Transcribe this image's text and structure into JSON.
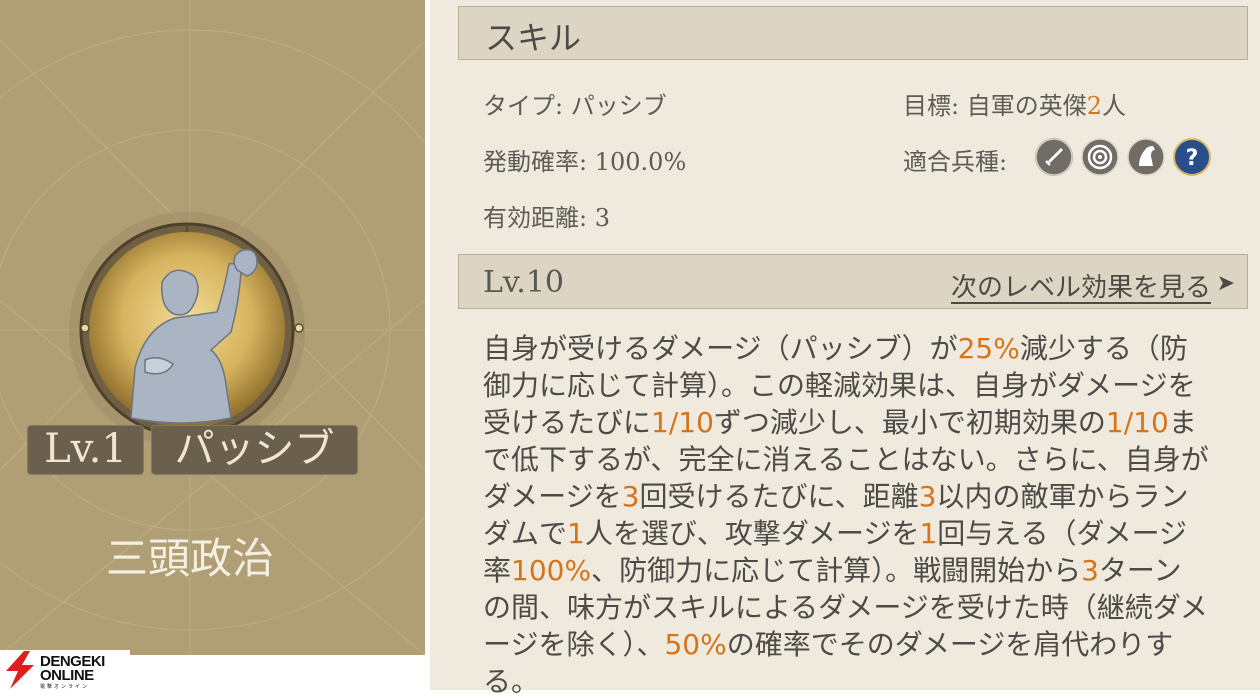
{
  "skill_card": {
    "level_badge": "Lv.1",
    "type_badge": "パッシブ",
    "skill_name": "三頭政治",
    "background_color": "#b09f75"
  },
  "branding": {
    "line1": "DENGEKI",
    "line2": "ONLINE",
    "line3": "電撃オンライン",
    "bolt_color": "#e01e1e"
  },
  "skill_panel": {
    "header_title": "スキル",
    "stats": {
      "type_label": "タイプ:",
      "type_value": "パッシブ",
      "target_label": "目標:",
      "target_value_prefix": "自軍の英傑",
      "target_count": "2",
      "target_value_suffix": "人",
      "activation_label": "発動確率:",
      "activation_value": "100.0%",
      "unit_label": "適合兵種:",
      "range_label": "有効距離:",
      "range_value": "3"
    },
    "unit_icons": [
      "sword-icon",
      "target-icon",
      "horse-icon",
      "question-icon"
    ],
    "level_label": "Lv.10",
    "next_level_link": "次のレベル効果を見る",
    "accent_color": "#d6741a",
    "description_lines": [
      [
        {
          "t": "自身が受けるダメージ（パッシブ）が"
        },
        {
          "t": "25%",
          "h": true
        },
        {
          "t": "減少する（防"
        }
      ],
      [
        {
          "t": "御力に応じて計算）。この軽減効果は、自身がダメージを"
        }
      ],
      [
        {
          "t": "受けるたびに"
        },
        {
          "t": "1/10",
          "h": true
        },
        {
          "t": "ずつ減少し、最小で初期効果の"
        },
        {
          "t": "1/10",
          "h": true
        },
        {
          "t": "ま"
        }
      ],
      [
        {
          "t": "で低下するが、完全に消えることはない。さらに、自身が"
        }
      ],
      [
        {
          "t": "ダメージを"
        },
        {
          "t": "3",
          "h": true
        },
        {
          "t": "回受けるたびに、距離"
        },
        {
          "t": "3",
          "h": true
        },
        {
          "t": "以内の敵軍からラン"
        }
      ],
      [
        {
          "t": "ダムで"
        },
        {
          "t": "1",
          "h": true
        },
        {
          "t": "人を選び、攻撃ダメージを"
        },
        {
          "t": "1",
          "h": true
        },
        {
          "t": "回与える（ダメージ"
        }
      ],
      [
        {
          "t": "率"
        },
        {
          "t": "100%",
          "h": true
        },
        {
          "t": "、防御力に応じて計算）。戦闘開始から"
        },
        {
          "t": "3",
          "h": true
        },
        {
          "t": "ターン"
        }
      ],
      [
        {
          "t": "の間、味方がスキルによるダメージを受けた時（継続ダメ"
        }
      ],
      [
        {
          "t": "ージを除く）、"
        },
        {
          "t": "50%",
          "h": true
        },
        {
          "t": "の確率でそのダメージを肩代わりす"
        }
      ],
      [
        {
          "t": "る。"
        }
      ]
    ]
  }
}
